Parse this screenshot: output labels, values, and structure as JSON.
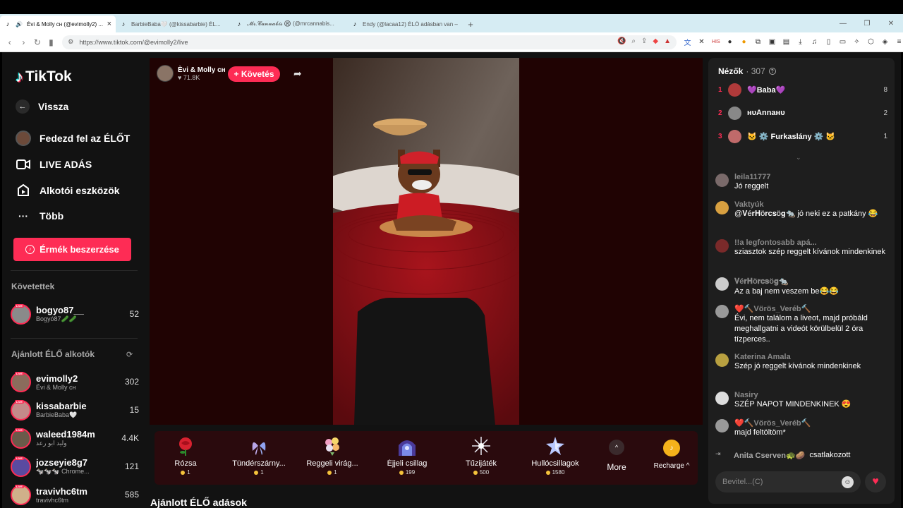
{
  "browser": {
    "tabs": [
      {
        "title": "Évi & Molly ᴄʜ (@evimolly2) ..."
      },
      {
        "title": "BarbieBaba🤍 (@kissabarbie) ÉL..."
      },
      {
        "title": "𝓜𝓻.𝓒𝓪𝓷𝓷𝓪𝓫𝓲𝓼 ®️ (@mrcannabis..."
      },
      {
        "title": "Endy (@lacaa12) ÉLŐ adásban van –"
      }
    ],
    "url": "https://www.tiktok.com/@evimolly2/live"
  },
  "sidebar": {
    "logo": "TikTok",
    "nav": {
      "back": "Vissza",
      "explore": "Fedezd fel az ÉLŐT",
      "go_live": "LIVE ADÁS",
      "creator_tools": "Alkotói eszközök",
      "more": "Több"
    },
    "coins_button": "Érmék beszerzése",
    "following_title": "Követettek",
    "following": [
      {
        "name": "bogyo87__",
        "sub": "Bogyó87🥒🥒",
        "count": "52"
      }
    ],
    "recommended_title": "Ajánlott ÉLŐ alkotók",
    "recommended": [
      {
        "name": "evimolly2",
        "sub": "Évi & Molly ᴄʜ",
        "count": "302"
      },
      {
        "name": "kissabarbie",
        "sub": "BarbieBaba🤍",
        "count": "15"
      },
      {
        "name": "waleed1984m",
        "sub": "وليد ابو رعد",
        "count": "4.4K"
      },
      {
        "name": "jozseyie8g7",
        "sub": "🐄🐄🐄 Chrome...",
        "count": "121"
      },
      {
        "name": "travivhc6tm",
        "sub": "travivhc6tm",
        "count": "585"
      }
    ]
  },
  "stream": {
    "host_name": "Èvi & Molly ᴄʜ",
    "host_likes": "71.8K",
    "follow_label": "+ Követés",
    "section_title": "Ajánlott ÉLŐ adások"
  },
  "gifts": {
    "items": [
      {
        "name": "Rózsa",
        "price": "1"
      },
      {
        "name": "Tündérszárny...",
        "price": "1"
      },
      {
        "name": "Reggeli virág...",
        "price": "1"
      },
      {
        "name": "Éjjeli csillag",
        "price": "199"
      },
      {
        "name": "Tűzijáték",
        "price": "500"
      },
      {
        "name": "Hullócsillagok",
        "price": "1580"
      }
    ],
    "more_label": "More",
    "recharge_label": "Recharge"
  },
  "chat": {
    "viewers_title": "Nézők",
    "viewers_count": "307",
    "top_viewers": [
      {
        "rank": "1",
        "name": "💜Baba💜",
        "score": "8"
      },
      {
        "rank": "2",
        "name": "ʜᴜAnnaʜᴜ",
        "score": "2"
      },
      {
        "rank": "3",
        "name": "🐱 ⚙️ Furkaslány ⚙️ 🐱",
        "score": "1"
      }
    ],
    "messages": [
      {
        "user": "leila11777",
        "text": "Jó reggelt"
      },
      {
        "user": "Vaktyúk",
        "text": "@𝐕é𝐫𝐇ö𝐫𝐜𝐬ö𝐠🐀 jó neki ez a patkány 😂"
      },
      {
        "user": "!!a legfontosabb apá...",
        "text": "sziasztok szép reggelt kívánok mindenkinek"
      },
      {
        "user": "𝐕é𝐫𝐇ö𝐫𝐜𝐬ö𝐠🐀",
        "text": "Az a baj nem veszem be😂😂"
      },
      {
        "user": "❤️🔨Vörös_Veréb🔨",
        "text": "Évi, nem találom a liveot, majd próbáld meghallgatni a videót körülbelül 2 óra tízperces.."
      },
      {
        "user": "Katerina Amala",
        "text": "Szép jó reggelt kívánok mindenkinek"
      },
      {
        "user": "Nasiry",
        "text": "SZÉP NAPOT MINDENKINEK 😍"
      },
      {
        "user": "❤️🔨Vörös_Veréb🔨",
        "text": "majd feltöltöm*"
      }
    ],
    "joined_user": "Anita Cserven🐢🥔",
    "joined_text": "csatlakozott",
    "input_placeholder": "Bevitel...(C)"
  },
  "colors": {
    "accent": "#fe2c55",
    "panel": "#1e1e1e",
    "stage": "#200303"
  }
}
